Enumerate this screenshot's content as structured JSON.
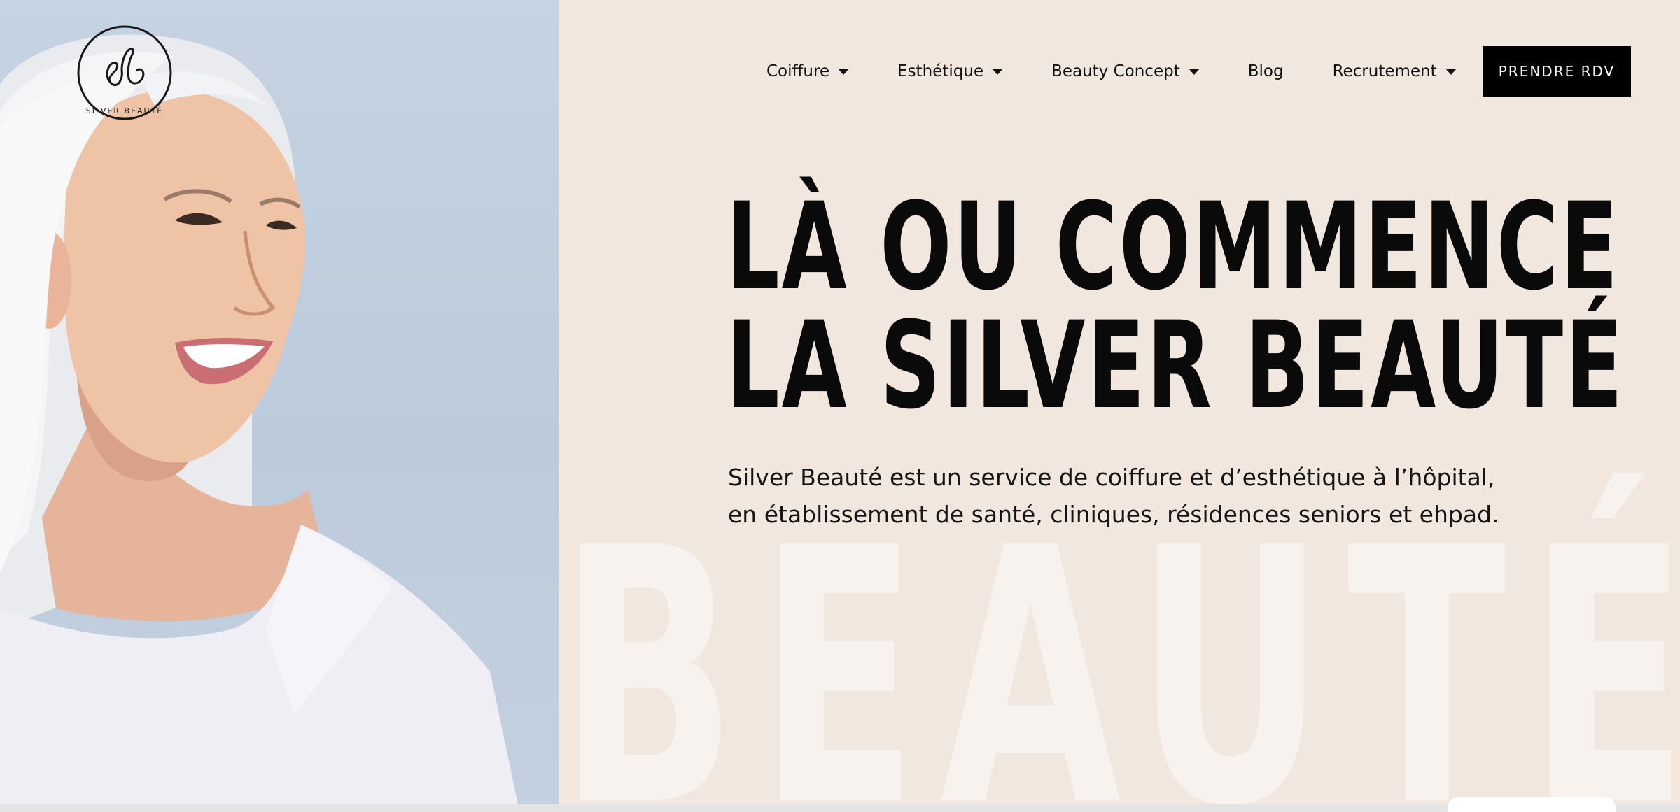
{
  "brand": {
    "monogram": "sb",
    "name": "SILVER BEAUTÉ"
  },
  "nav": {
    "items": [
      {
        "label": "Coiffure",
        "has_dropdown": true
      },
      {
        "label": "Esthétique",
        "has_dropdown": true
      },
      {
        "label": "Beauty Concept",
        "has_dropdown": true
      },
      {
        "label": "Blog",
        "has_dropdown": false
      },
      {
        "label": "Recrutement",
        "has_dropdown": true
      }
    ],
    "cta_label": "PRENDRE RDV"
  },
  "hero": {
    "headline_line1": "LÀ OU COMMENCE",
    "headline_line2": "LA SILVER BEAUTÉ",
    "intro": "Silver Beauté est un service de coiffure et d’esthétique à l’hôpital, en établissement de santé, cliniques, résidences seniors et ehpad.",
    "watermark": "BEAUTÉ",
    "photo_icon": "smiling-senior-woman-photo"
  },
  "colors": {
    "background": "#f1e7df",
    "photo_background": "#c5d3e2",
    "text": "#0a0a0a",
    "cta_background": "#000000",
    "cta_text": "#ffffff",
    "watermark": "#f7f2ee"
  }
}
